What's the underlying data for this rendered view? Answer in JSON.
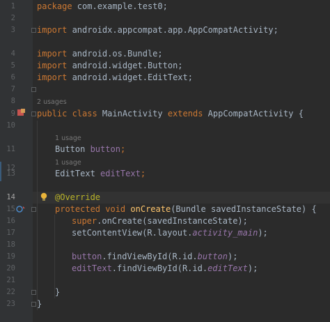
{
  "editor": {
    "line_numbers": [
      "1",
      "2",
      "3",
      "4",
      "5",
      "6",
      "7",
      "8",
      "9",
      "10",
      "11",
      "12",
      "13",
      "14",
      "15",
      "16",
      "17",
      "18",
      "19",
      "20",
      "21",
      "22",
      "23"
    ],
    "current_line": "14",
    "hints": {
      "class_usages": "2 usages",
      "button_usages": "1 usage",
      "edittext_usages": "1 usage"
    },
    "lines": {
      "l1_kw": "package",
      "l1_rest": " com.example.test0;",
      "l3_kw": "import",
      "l3_rest": " androidx.appcompat.app.AppCompatActivity;",
      "l5_kw": "import",
      "l5_rest": " android.os.Bundle;",
      "l6_kw": "import",
      "l6_rest": " android.widget.Button;",
      "l7_kw": "import",
      "l7_rest": " android.widget.EditText;",
      "l9_kw1": "public class",
      "l9_cls": " MainActivity ",
      "l9_kw2": "extends",
      "l9_rest": " AppCompatActivity {",
      "l11_type": "Button ",
      "l11_field": "button",
      "l11_end": ";",
      "l13_type": "EditText ",
      "l13_field": "editText",
      "l13_end": ";",
      "l14_ann": "@Override",
      "l15_kw": "protected void",
      "l15_sp": " ",
      "l15_method": "onCreate",
      "l15_rest": "(Bundle savedInstanceState) {",
      "l16_kw": "super",
      "l16_rest": ".onCreate(savedInstanceState);",
      "l17_a": "setContentView(R.layout.",
      "l17_it": "activity_main",
      "l17_b": ");",
      "l19_field": "button",
      "l19_a": ".findViewById(R.id.",
      "l19_it": "button",
      "l19_b": ");",
      "l20_field": "editText",
      "l20_a": ".findViewById(R.id.",
      "l20_it": "editText",
      "l20_b": ");",
      "l22": "}",
      "l23": "}"
    },
    "icons": {
      "bulb": "intention-bulb-icon",
      "run": "run-class-icon",
      "override": "override-method-icon"
    }
  }
}
